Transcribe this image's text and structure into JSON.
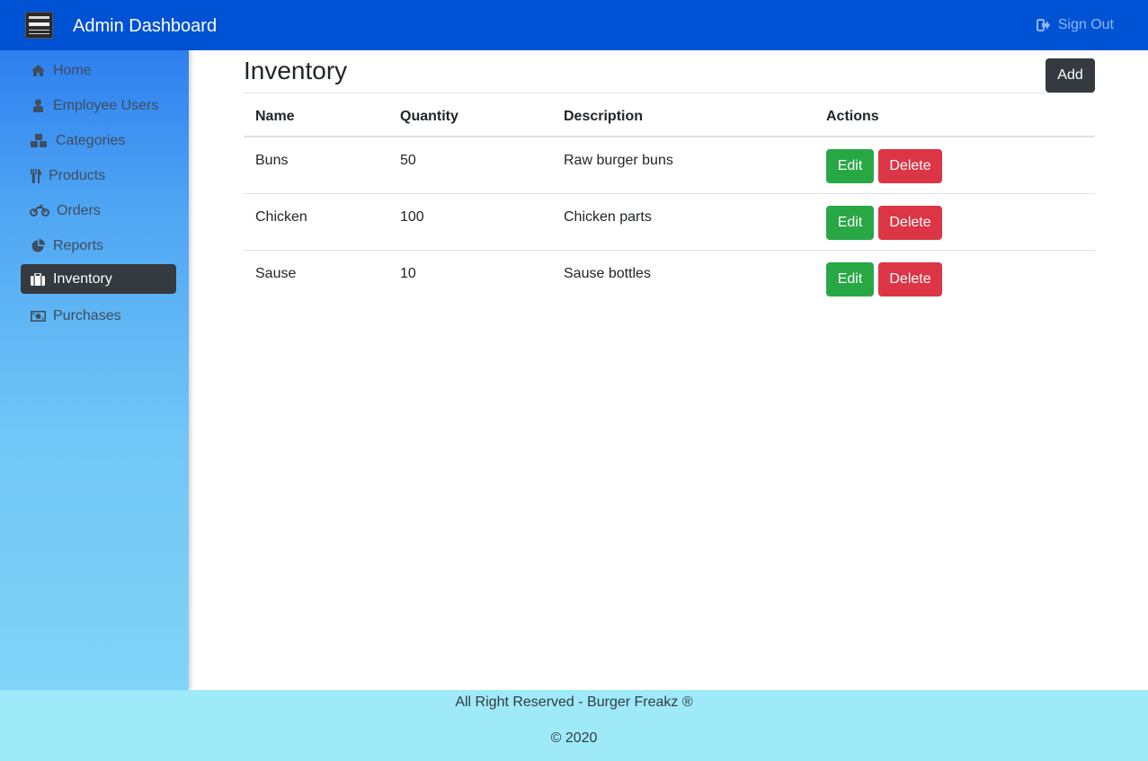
{
  "header": {
    "title": "Admin Dashboard",
    "sign_out_label": "Sign Out"
  },
  "sidebar": {
    "items": [
      {
        "label": "Home",
        "icon": "home-icon"
      },
      {
        "label": "Employee Users",
        "icon": "user-icon"
      },
      {
        "label": "Categories",
        "icon": "cubes-icon"
      },
      {
        "label": "Products",
        "icon": "cutlery-icon"
      },
      {
        "label": "Orders",
        "icon": "motorcycle-icon"
      },
      {
        "label": "Reports",
        "icon": "pie-chart-icon"
      },
      {
        "label": "Inventory",
        "icon": "suitcase-icon",
        "active": true
      },
      {
        "label": "Purchases",
        "icon": "money-icon"
      }
    ]
  },
  "main": {
    "title": "Inventory",
    "add_label": "Add",
    "columns": [
      "Name",
      "Quantity",
      "Description",
      "Actions"
    ],
    "rows": [
      {
        "name": "Buns",
        "quantity": "50",
        "description": "Raw burger buns",
        "edit_label": "Edit",
        "delete_label": "Delete"
      },
      {
        "name": "Chicken",
        "quantity": "100",
        "description": "Chicken parts",
        "edit_label": "Edit",
        "delete_label": "Delete"
      },
      {
        "name": "Sause",
        "quantity": "10",
        "description": "Sause bottles",
        "edit_label": "Edit",
        "delete_label": "Delete"
      }
    ]
  },
  "footer": {
    "line1": "All Right Reserved - Burger Freakz ®",
    "line2": "© 2020"
  },
  "colors": {
    "header_bg": "#0052d4",
    "active_nav_bg": "#343a40",
    "edit_button": "#28a745",
    "delete_button": "#dc3545",
    "footer_bg": "#9eeaf9"
  }
}
